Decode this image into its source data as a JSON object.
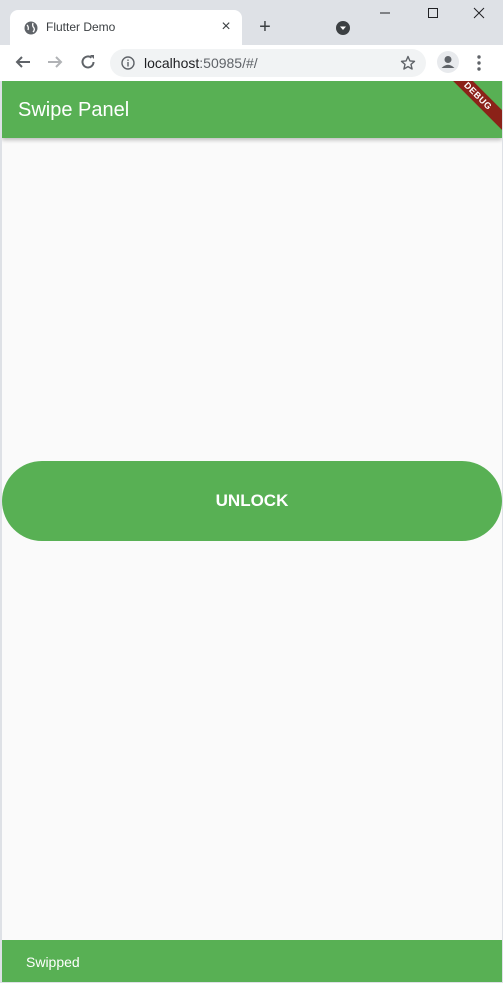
{
  "browser": {
    "tab_title": "Flutter Demo",
    "url_host": "localhost",
    "url_rest": ":50985/#/",
    "icons": {
      "favicon": "globe-icon",
      "tab_close": "close-icon",
      "new_tab": "plus-icon",
      "tab_search": "dropdown-circle-icon",
      "back": "arrow-left-icon",
      "forward": "arrow-right-icon",
      "reload": "reload-icon",
      "site_info": "info-icon",
      "bookmark": "star-icon",
      "profile": "account-icon",
      "menu": "kebab-menu-icon",
      "minimize": "minimize-icon",
      "maximize": "maximize-icon",
      "close_window": "close-icon"
    }
  },
  "app": {
    "appbar_title": "Swipe Panel",
    "debug_banner": "DEBUG",
    "swipe_label": "UNLOCK",
    "snackbar_text": "Swipped",
    "colors": {
      "primary": "#58b054",
      "background": "#fafafa",
      "debug": "#8b2218"
    }
  }
}
